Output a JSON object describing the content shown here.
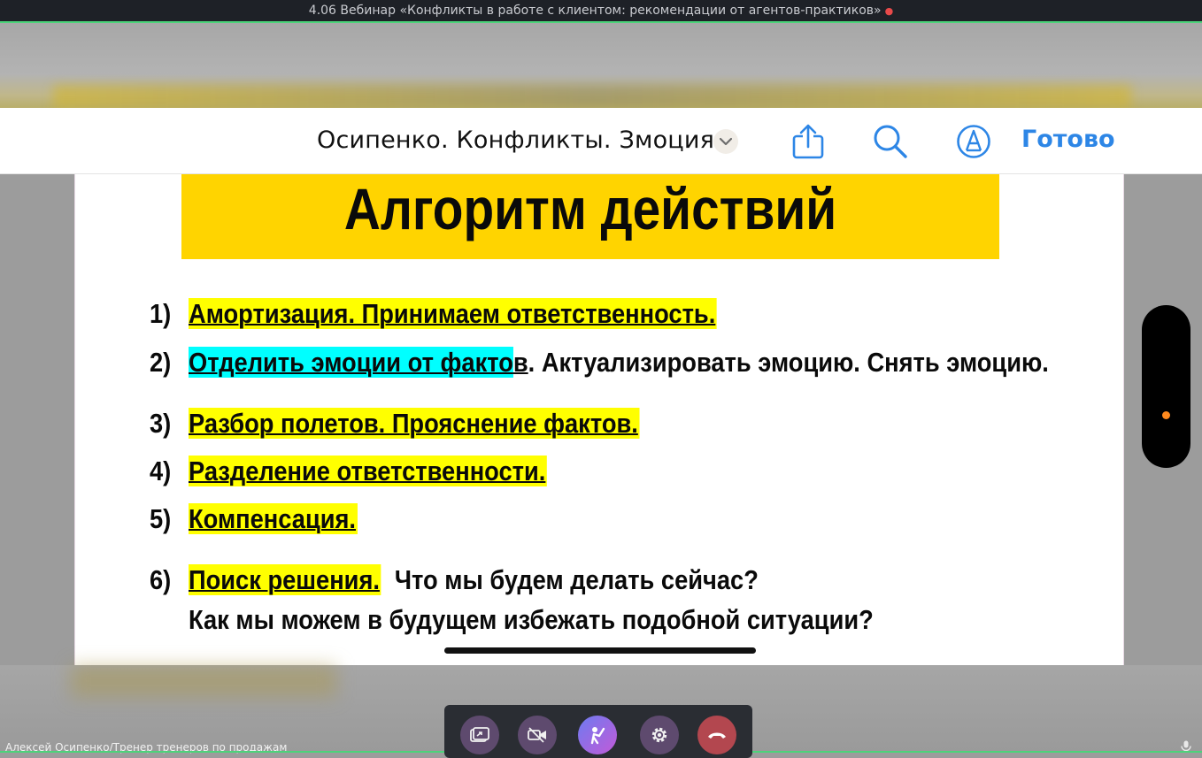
{
  "window": {
    "title": "4.06 Вебинар «Конфликты в работе с клиентом: рекомендации от агентов-практиков»",
    "recording_dot": "●"
  },
  "viewer": {
    "document_title": "Осипенко. Конфликты. Змоция",
    "done_label": "Готово",
    "icons": [
      "chevron-down-icon",
      "share-icon",
      "search-icon",
      "markup-pen-icon"
    ]
  },
  "slide": {
    "title": "Алгоритм действий",
    "items": [
      {
        "num": "1)",
        "highlight": "Амортизация. Принимаем ответственность.",
        "rest": ""
      },
      {
        "num": "2)",
        "highlight": "Отделить эмоции от факто",
        "rest_underlined": "в",
        "rest": ". Актуализировать эмоцию. Снять эмоцию."
      },
      {
        "num": "3)",
        "highlight": "Разбор полетов. Прояснение фактов.",
        "rest": ""
      },
      {
        "num": "4)",
        "highlight": "Разделение ответственности.",
        "rest": ""
      },
      {
        "num": "5)",
        "highlight": "Компенсация.",
        "rest": ""
      },
      {
        "num": "6)",
        "highlight": "Поиск решения.",
        "rest": "  Что мы будем делать сейчас?"
      }
    ],
    "continuation": "Как мы можем в будущем избежать подобной ситуации?"
  },
  "call": {
    "speaker": "Алексей Осипенко/Тренер тренеров по продажам",
    "buttons": [
      {
        "name": "screen-share-button",
        "icon": "screen-share-icon",
        "color": "#5e4a6e"
      },
      {
        "name": "camera-off-button",
        "icon": "camera-off-icon",
        "color": "#5e4a6e"
      },
      {
        "name": "raise-hand-button",
        "icon": "raise-hand-icon",
        "color": "#9b6be0"
      },
      {
        "name": "settings-button",
        "icon": "gear-icon",
        "color": "#5e4a6e"
      },
      {
        "name": "end-call-button",
        "icon": "hang-up-icon",
        "color": "#b3474f"
      }
    ]
  },
  "colors": {
    "accent_blue": "#2d86e6",
    "banner_yellow": "#ffd400",
    "highlight_yellow": "#ffff00",
    "highlight_cyan": "#00ffff",
    "active_green": "#4cd37a"
  }
}
